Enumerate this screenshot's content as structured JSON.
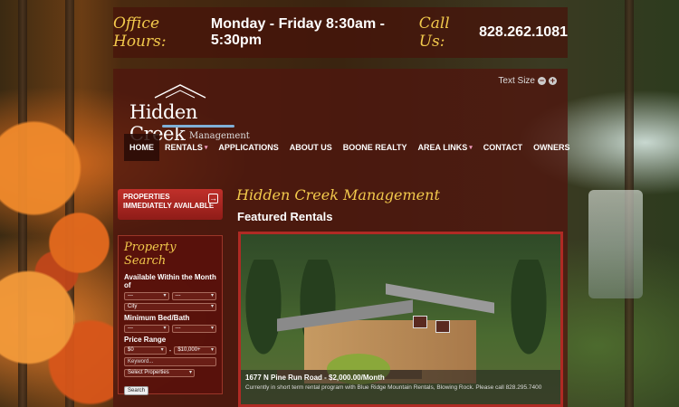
{
  "header": {
    "hours_label": "Office Hours:",
    "hours_value": "Monday - Friday 8:30am - 5:30pm",
    "call_label": "Call Us:",
    "phone": "828.262.1081"
  },
  "logo": {
    "name": "Hidden Creek",
    "sub": "Management"
  },
  "text_size": {
    "label": "Text Size",
    "decrease": "−",
    "increase": "+"
  },
  "nav": [
    {
      "label": "HOME",
      "dropdown": false
    },
    {
      "label": "RENTALS",
      "dropdown": true
    },
    {
      "label": "APPLICATIONS",
      "dropdown": false
    },
    {
      "label": "ABOUT US",
      "dropdown": false
    },
    {
      "label": "BOONE REALTY",
      "dropdown": false
    },
    {
      "label": "AREA LINKS",
      "dropdown": true
    },
    {
      "label": "CONTACT",
      "dropdown": false
    },
    {
      "label": "OWNERS",
      "dropdown": false
    }
  ],
  "cta": {
    "label": "PROPERTIES IMMEDIATELY AVAILABLE",
    "arrow": "→"
  },
  "search": {
    "title": "Property Search",
    "month_label": "Available Within the Month of",
    "month_value": "---",
    "year_value": "---",
    "city_value": "City",
    "bedbath_label": "Minimum Bed/Bath",
    "bed_value": "---",
    "bath_value": "---",
    "price_label": "Price Range",
    "price_min": "$0",
    "price_sep": "-",
    "price_max": "$10,000+",
    "keyword_placeholder": "Keyword...",
    "properties_value": "Select Properties",
    "button": "Search"
  },
  "main": {
    "title": "Hidden Creek Management",
    "featured": "Featured Rentals",
    "listing_title": "1677 N Pine Run Road - $2,000.00/Month",
    "listing_text": "Currently in short term rental program with Blue Ridge Mountain Rentals, Blowing Rock. Please call 828.295.7400"
  },
  "colors": {
    "accent_gold": "#f2c94c",
    "panel": "#50160e",
    "cta_red": "#c0302a"
  }
}
